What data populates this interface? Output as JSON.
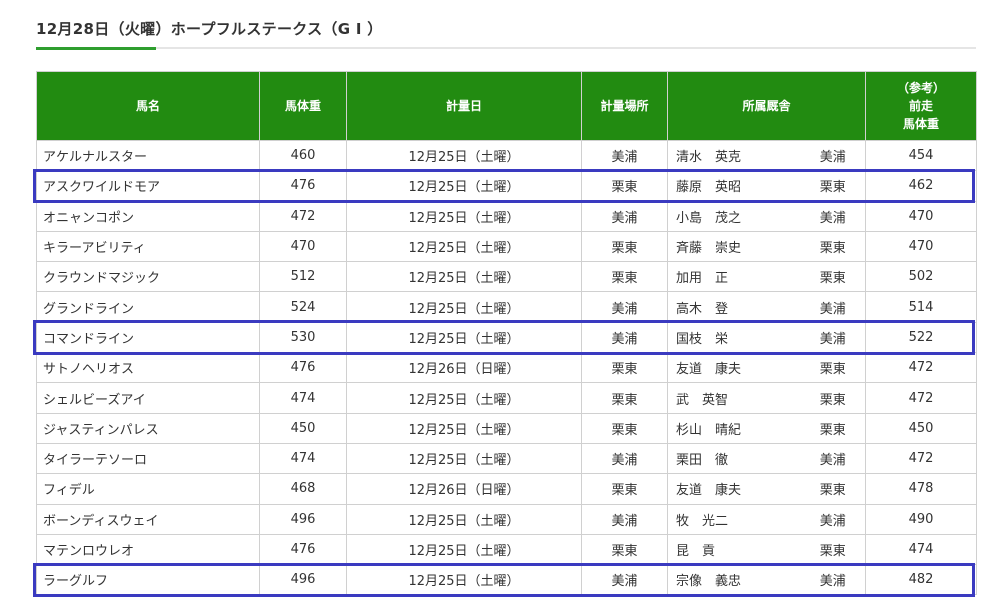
{
  "heading": "12月28日（火曜）ホープフルステークス（G I ）",
  "table": {
    "headers": {
      "horse": "馬名",
      "weight": "馬体重",
      "date": "計量日",
      "place": "計量場所",
      "stable": "所属厩舎",
      "prev_line1": "（参考）",
      "prev_line2": "前走",
      "prev_line3": "馬体重"
    },
    "rows": [
      {
        "horse": "アケルナルスター",
        "weight": "460",
        "date": "12月25日（土曜）",
        "place": "美浦",
        "trainer": "清水　英克",
        "trainer_loc": "美浦",
        "prev": "454"
      },
      {
        "horse": "アスクワイルドモア",
        "weight": "476",
        "date": "12月25日（土曜）",
        "place": "栗東",
        "trainer": "藤原　英昭",
        "trainer_loc": "栗東",
        "prev": "462"
      },
      {
        "horse": "オニャンコポン",
        "weight": "472",
        "date": "12月25日（土曜）",
        "place": "美浦",
        "trainer": "小島　茂之",
        "trainer_loc": "美浦",
        "prev": "470"
      },
      {
        "horse": "キラーアビリティ",
        "weight": "470",
        "date": "12月25日（土曜）",
        "place": "栗東",
        "trainer": "斉藤　崇史",
        "trainer_loc": "栗東",
        "prev": "470"
      },
      {
        "horse": "クラウンドマジック",
        "weight": "512",
        "date": "12月25日（土曜）",
        "place": "栗東",
        "trainer": "加用　正",
        "trainer_loc": "栗東",
        "prev": "502"
      },
      {
        "horse": "グランドライン",
        "weight": "524",
        "date": "12月25日（土曜）",
        "place": "美浦",
        "trainer": "高木　登",
        "trainer_loc": "美浦",
        "prev": "514"
      },
      {
        "horse": "コマンドライン",
        "weight": "530",
        "date": "12月25日（土曜）",
        "place": "美浦",
        "trainer": "国枝　栄",
        "trainer_loc": "美浦",
        "prev": "522"
      },
      {
        "horse": "サトノヘリオス",
        "weight": "476",
        "date": "12月26日（日曜）",
        "place": "栗東",
        "trainer": "友道　康夫",
        "trainer_loc": "栗東",
        "prev": "472"
      },
      {
        "horse": "シェルビーズアイ",
        "weight": "474",
        "date": "12月25日（土曜）",
        "place": "栗東",
        "trainer": "武　英智",
        "trainer_loc": "栗東",
        "prev": "472"
      },
      {
        "horse": "ジャスティンパレス",
        "weight": "450",
        "date": "12月25日（土曜）",
        "place": "栗東",
        "trainer": "杉山　晴紀",
        "trainer_loc": "栗東",
        "prev": "450"
      },
      {
        "horse": "タイラーテソーロ",
        "weight": "474",
        "date": "12月25日（土曜）",
        "place": "美浦",
        "trainer": "栗田　徹",
        "trainer_loc": "美浦",
        "prev": "472"
      },
      {
        "horse": "フィデル",
        "weight": "468",
        "date": "12月26日（日曜）",
        "place": "栗東",
        "trainer": "友道　康夫",
        "trainer_loc": "栗東",
        "prev": "478"
      },
      {
        "horse": "ボーンディスウェイ",
        "weight": "496",
        "date": "12月25日（土曜）",
        "place": "美浦",
        "trainer": "牧　光二",
        "trainer_loc": "美浦",
        "prev": "490"
      },
      {
        "horse": "マテンロウレオ",
        "weight": "476",
        "date": "12月25日（土曜）",
        "place": "栗東",
        "trainer": "昆　貢",
        "trainer_loc": "栗東",
        "prev": "474"
      },
      {
        "horse": "ラーグルフ",
        "weight": "496",
        "date": "12月25日（土曜）",
        "place": "美浦",
        "trainer": "宗像　義忠",
        "trainer_loc": "美浦",
        "prev": "482"
      }
    ]
  },
  "highlighted_horses": [
    "アスクワイルドモア",
    "コマンドライン",
    "ラーグルフ"
  ],
  "colors": {
    "header_bg": "#228b11",
    "highlight_border": "#3a3ac0",
    "accent": "#2e9e2e"
  }
}
